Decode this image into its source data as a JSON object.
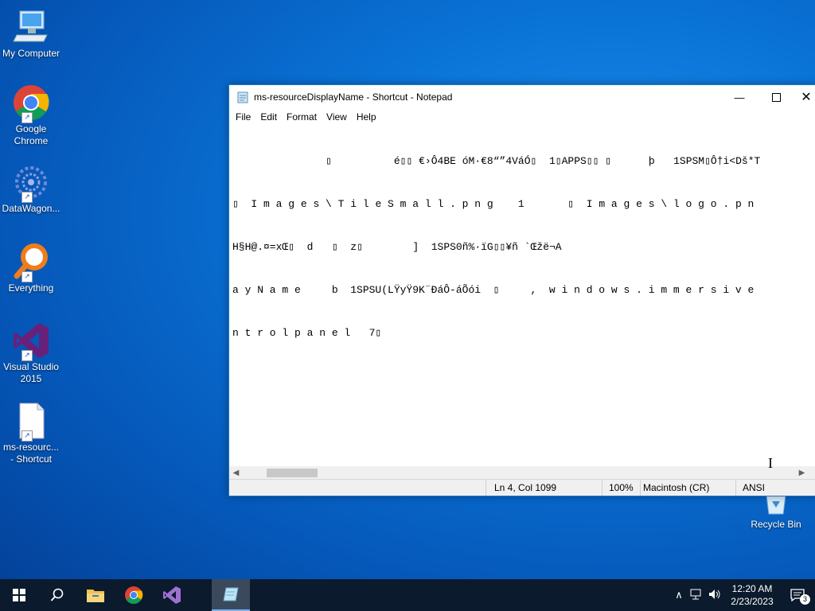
{
  "desktop": {
    "icons": [
      {
        "label": "My Computer",
        "icon": "computer-icon"
      },
      {
        "label": "Google Chrome",
        "icon": "chrome-icon"
      },
      {
        "label": "DataWagon...",
        "icon": "datawagon-icon"
      },
      {
        "label": "Everything",
        "icon": "everything-search-icon"
      },
      {
        "label": "Visual Studio 2015",
        "icon": "visual-studio-icon"
      },
      {
        "label": "ms-resourc... - Shortcut",
        "icon": "file-shortcut-icon"
      }
    ],
    "recycle_bin_label": "Recycle Bin"
  },
  "notepad": {
    "title": "ms-resourceDisplayName - Shortcut - Notepad",
    "menu": [
      "File",
      "Edit",
      "Format",
      "View",
      "Help"
    ],
    "content_lines": [
      "               ▯          é▯▯ €›Ô4BE óM·€8“”4VáÓ▯  1▯APPS▯▯ ▯      þ   1SPSM▯Ô†i<Dš*T",
      "▯  I m a g e s \\ T i l e S m a l l . p n g    1       ▯  I m a g e s \\ l o g o . p n",
      "H§H@.¤=xŒ▯  d   ▯  z▯        ]  1SPS0ñ%·ïG▯▯¥ñ `Œžë¬A",
      "a y N a m e     b  1SPSU(LŸyŸ9K¨ĐáÔ-áÕói  ▯     ,  w i n d o w s . i m m e r s i v e",
      "n t r o l p a n e l   7▯"
    ],
    "status": {
      "position": "Ln 4, Col 1099",
      "zoom": "100%",
      "line_ending": "Macintosh (CR)",
      "encoding": "ANSI"
    }
  },
  "taskbar": {
    "time": "12:20 AM",
    "date": "2/23/2023",
    "notification_count": "3"
  }
}
